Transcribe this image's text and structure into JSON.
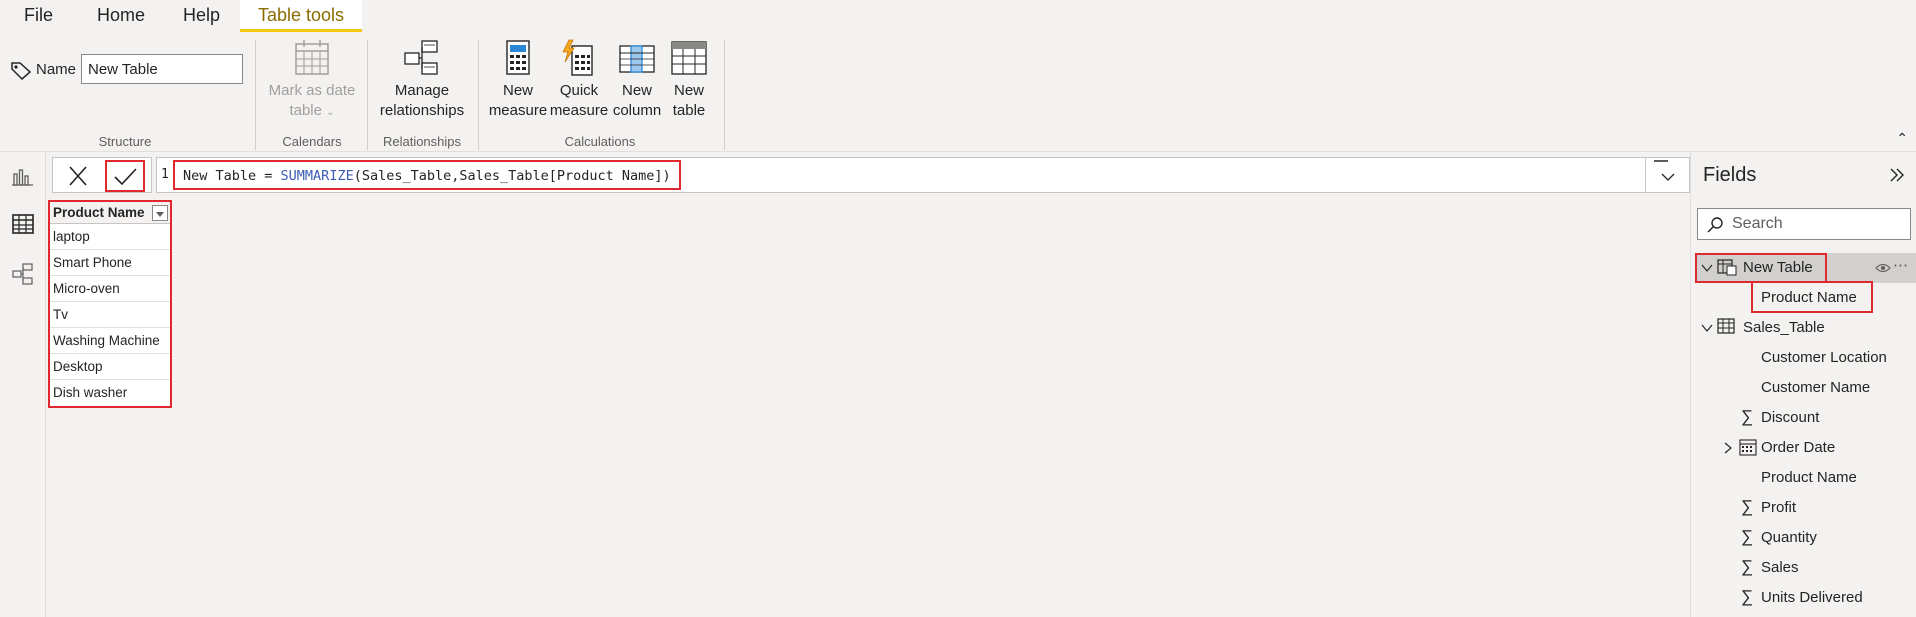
{
  "menu": {
    "tabs": [
      "File",
      "Home",
      "Help",
      "Table tools"
    ],
    "active_tab": "Table tools"
  },
  "ribbon": {
    "name_label": "Name",
    "name_value": "New Table",
    "groups": {
      "structure": "Structure",
      "calendars": "Calendars",
      "relationships": "Relationships",
      "calculations": "Calculations"
    },
    "buttons": {
      "mark_date_line1": "Mark as date",
      "mark_date_line2": "table",
      "manage_line1": "Manage",
      "manage_line2": "relationships",
      "new_measure_line1": "New",
      "new_measure_line2": "measure",
      "quick_measure_line1": "Quick",
      "quick_measure_line2": "measure",
      "new_column_line1": "New",
      "new_column_line2": "column",
      "new_table_line1": "New",
      "new_table_line2": "table"
    }
  },
  "formula": {
    "line_number": "1",
    "prefix": "New Table = ",
    "function": "SUMMARIZE",
    "args": "(Sales_Table,Sales_Table[Product Name])"
  },
  "table": {
    "column_header": "Product Name",
    "rows": [
      "laptop",
      "Smart Phone",
      "Micro-oven",
      "Tv",
      "Washing Machine",
      "Desktop",
      "Dish washer"
    ]
  },
  "fields": {
    "title": "Fields",
    "search_placeholder": "Search",
    "new_table": {
      "name": "New Table",
      "columns": [
        "Product Name"
      ]
    },
    "sales_table": {
      "name": "Sales_Table",
      "columns": [
        "Customer Location",
        "Customer Name",
        "Discount",
        "Order Date",
        "Product Name",
        "Profit",
        "Quantity",
        "Sales",
        "Units Delivered"
      ]
    }
  },
  "colors": {
    "accent": "#f2c811",
    "highlight": "#e0282f"
  }
}
